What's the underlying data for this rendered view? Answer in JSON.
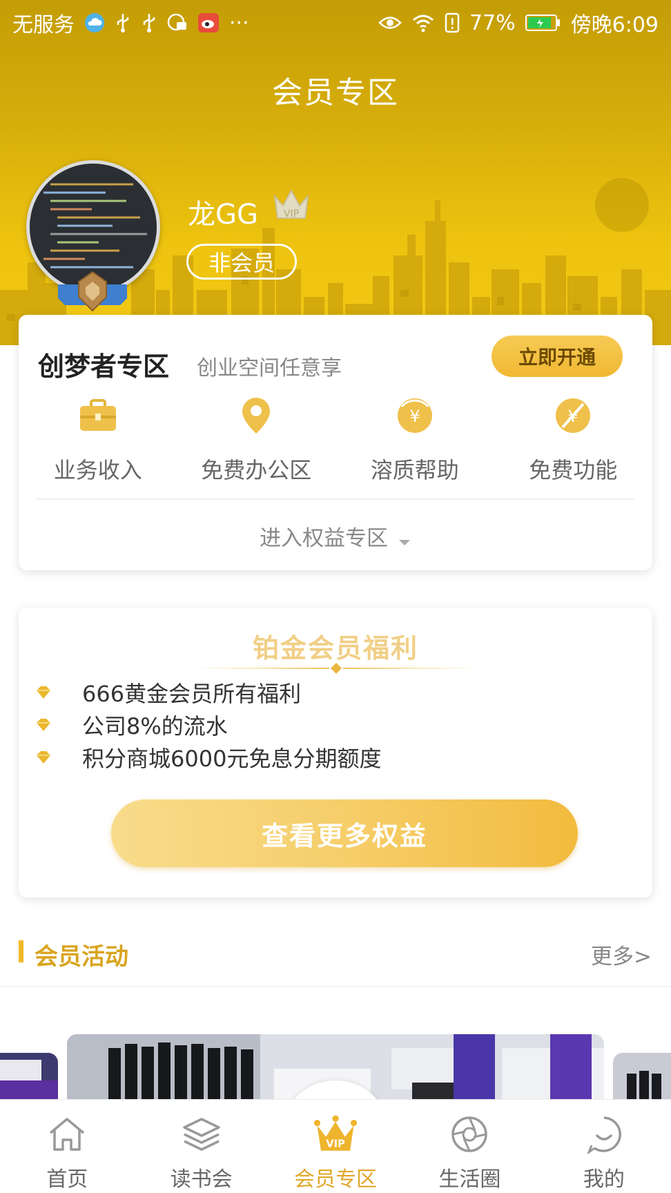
{
  "status_bar": {
    "carrier": "无服务",
    "more": "···",
    "battery_percent": "77%",
    "time": "傍晚6:09"
  },
  "header": {
    "title": "会员专区",
    "username": "龙GG",
    "vip_badge": "VIP",
    "membership_status": "非会员"
  },
  "zone_card": {
    "title": "创梦者专区",
    "subtitle": "创业空间任意享",
    "action": "立即开通",
    "features": [
      {
        "label": "业务收入",
        "icon": "briefcase-icon"
      },
      {
        "label": "免费办公区",
        "icon": "location-pin-icon"
      },
      {
        "label": "溶质帮助",
        "icon": "yuan-coin-icon"
      },
      {
        "label": "免费功能",
        "icon": "yuan-slash-icon"
      }
    ],
    "enter_rights": "进入权益专区"
  },
  "welfare_card": {
    "title": "铂金会员福利",
    "benefits": [
      "666黄金会员所有福利",
      "公司8%的流水",
      "积分商城6000元免息分期额度"
    ],
    "more_button": "查看更多权益"
  },
  "activities": {
    "title": "会员活动",
    "more": "更多>"
  },
  "tab_bar": {
    "tabs": [
      {
        "label": "首页",
        "icon": "home-icon",
        "active": false
      },
      {
        "label": "读书会",
        "icon": "layers-icon",
        "active": false
      },
      {
        "label": "会员专区",
        "icon": "vip-crown-icon",
        "active": true
      },
      {
        "label": "生活圈",
        "icon": "aperture-icon",
        "active": false
      },
      {
        "label": "我的",
        "icon": "profile-icon",
        "active": false
      }
    ]
  },
  "colors": {
    "header_gold": "#c39d05",
    "accent": "#f0b928",
    "active_tab": "#e0a72a"
  }
}
